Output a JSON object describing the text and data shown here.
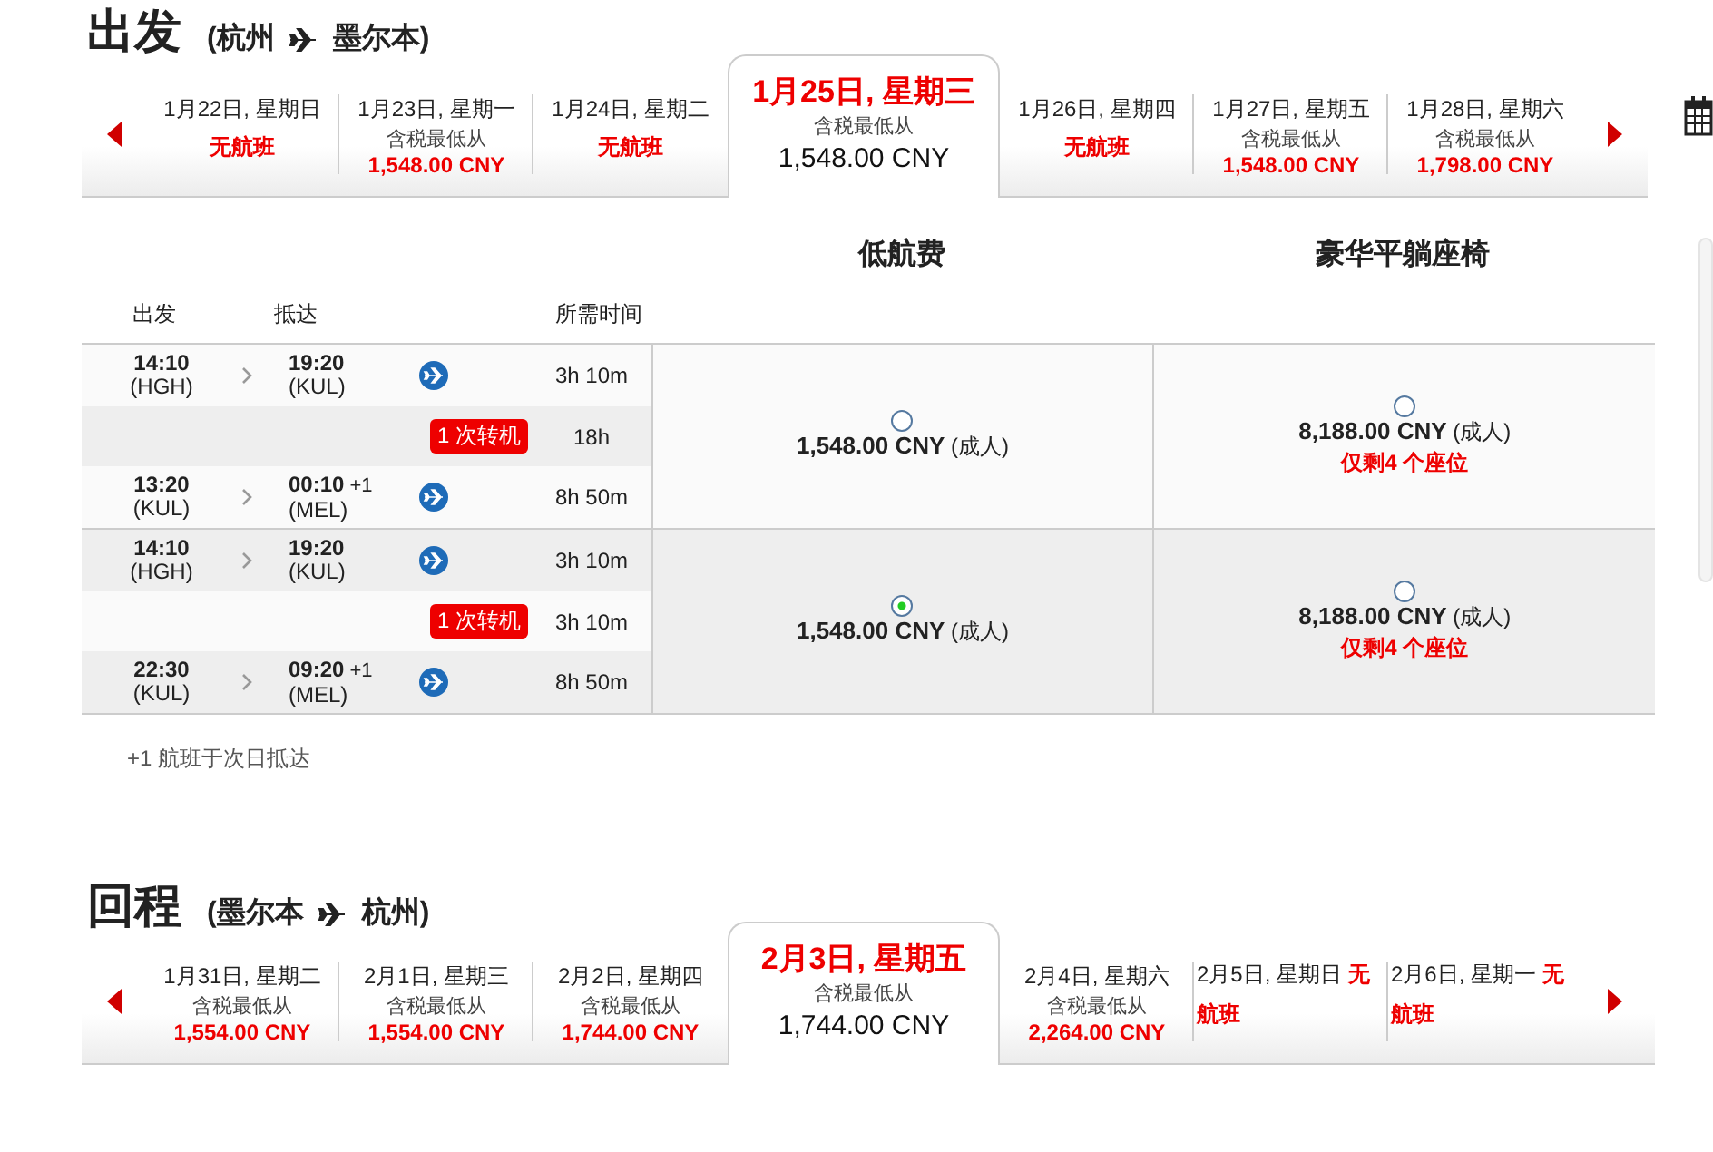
{
  "outbound": {
    "title": "出发",
    "from": "(杭州",
    "to": "墨尔本)",
    "dates": [
      {
        "kind": "none",
        "date": "1月22日, 星期日",
        "note": "无航班",
        "selected": false
      },
      {
        "kind": "price",
        "date": "1月23日, 星期一",
        "caption": "含税最低从",
        "price": "1,548.00 CNY",
        "selected": false
      },
      {
        "kind": "none",
        "date": "1月24日, 星期二",
        "note": "无航班",
        "selected": false
      },
      {
        "kind": "price",
        "date": "1月25日, 星期三",
        "caption": "含税最低从",
        "price": "1,548.00 CNY",
        "selected": true
      },
      {
        "kind": "none",
        "date": "1月26日, 星期四",
        "note": "无航班",
        "selected": false
      },
      {
        "kind": "price",
        "date": "1月27日, 星期五",
        "caption": "含税最低从",
        "price": "1,548.00 CNY",
        "selected": false
      },
      {
        "kind": "price",
        "date": "1月28日, 星期六",
        "caption": "含税最低从",
        "price": "1,798.00 CNY",
        "selected": false
      }
    ]
  },
  "fare_headers": [
    "低航费",
    "豪华平躺座椅"
  ],
  "columns": {
    "depart": "出发",
    "arrive": "抵达",
    "duration": "所需时间"
  },
  "itineraries": [
    {
      "segments": [
        {
          "dep_time": "14:10",
          "dep_airport": "(HGH)",
          "arr_time": "19:20",
          "arr_airport": "(KUL)",
          "duration": "3h 10m"
        },
        {
          "dep_time": "13:20",
          "dep_airport": "(KUL)",
          "arr_time": "00:10",
          "next_day": "+1",
          "arr_airport": "(MEL)",
          "duration": "8h 50m"
        }
      ],
      "connection": {
        "label": "1 次转机",
        "duration": "18h"
      },
      "fares": [
        {
          "price": "1,548.00 CNY",
          "pax": "(成人)",
          "selected": false
        },
        {
          "price": "8,188.00 CNY",
          "pax": "(成人)",
          "seats": "仅剩4 个座位",
          "selected": false
        }
      ]
    },
    {
      "segments": [
        {
          "dep_time": "14:10",
          "dep_airport": "(HGH)",
          "arr_time": "19:20",
          "arr_airport": "(KUL)",
          "duration": "3h 10m"
        },
        {
          "dep_time": "22:30",
          "dep_airport": "(KUL)",
          "arr_time": "09:20",
          "next_day": "+1",
          "arr_airport": "(MEL)",
          "duration": "8h 50m"
        }
      ],
      "connection": {
        "label": "1 次转机",
        "duration": "3h 10m"
      },
      "fares": [
        {
          "price": "1,548.00 CNY",
          "pax": "(成人)",
          "selected": true
        },
        {
          "price": "8,188.00 CNY",
          "pax": "(成人)",
          "seats": "仅剩4 个座位",
          "selected": false
        }
      ]
    }
  ],
  "footnote": "+1 航班于次日抵达",
  "return": {
    "title": "回程",
    "from": "(墨尔本",
    "to": "杭州)",
    "dates": [
      {
        "kind": "price",
        "date": "1月31日, 星期二",
        "caption": "含税最低从",
        "price": "1,554.00 CNY",
        "selected": false
      },
      {
        "kind": "price",
        "date": "2月1日, 星期三",
        "caption": "含税最低从",
        "price": "1,554.00 CNY",
        "selected": false
      },
      {
        "kind": "price",
        "date": "2月2日, 星期四",
        "caption": "含税最低从",
        "price": "1,744.00 CNY",
        "selected": false
      },
      {
        "kind": "price",
        "date": "2月3日, 星期五",
        "caption": "含税最低从",
        "price": "1,744.00 CNY",
        "selected": true
      },
      {
        "kind": "price",
        "date": "2月4日, 星期六",
        "caption": "含税最低从",
        "price": "2,264.00 CNY",
        "selected": false
      },
      {
        "kind": "none_inline",
        "date": "2月5日, 星期日",
        "note": "无航班",
        "selected": false
      },
      {
        "kind": "none_inline",
        "date": "2月6日, 星期一",
        "note": "无航班",
        "selected": false
      }
    ]
  }
}
